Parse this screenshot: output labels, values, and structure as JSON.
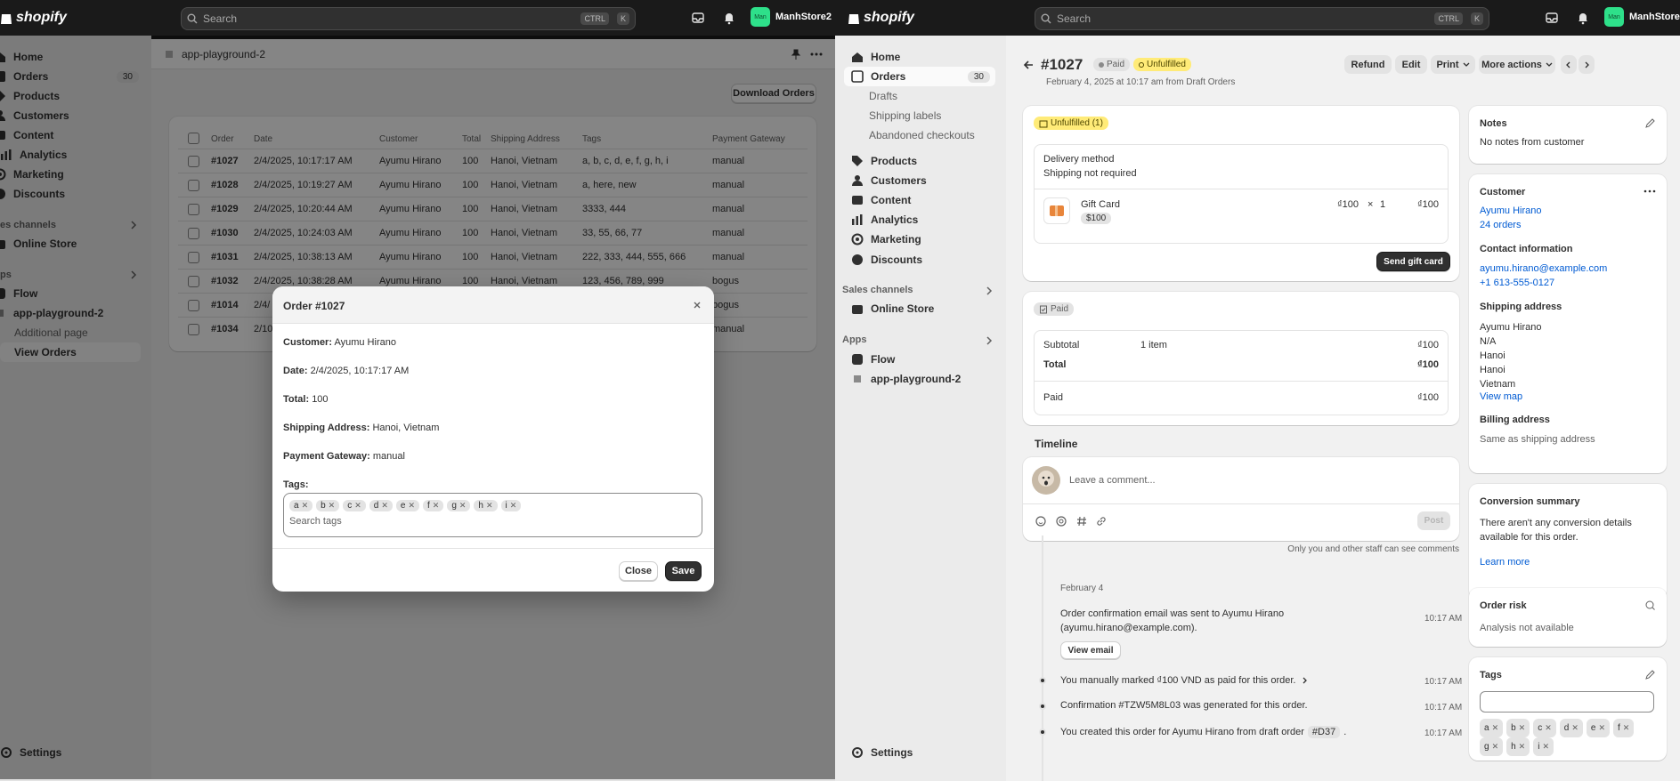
{
  "left": {
    "brand": "shopify",
    "search_placeholder": "Search",
    "kbd": [
      "CTRL",
      "K"
    ],
    "store_name": "ManhStore2",
    "avatar_initials": "Man",
    "nav": [
      {
        "label": "Home"
      },
      {
        "label": "Orders",
        "count": "30"
      },
      {
        "label": "Products"
      },
      {
        "label": "Customers"
      },
      {
        "label": "Content"
      },
      {
        "label": "Analytics"
      },
      {
        "label": "Marketing"
      },
      {
        "label": "Discounts"
      }
    ],
    "sales_channels_label": "es channels",
    "online_store": "Online Store",
    "apps_label": "ps",
    "flow": "Flow",
    "app_name": "app-playground-2",
    "additional_page": "Additional page",
    "view_orders": "View Orders",
    "settings": "Settings",
    "app_header": "app-playground-2",
    "download_button": "Download Orders",
    "table": {
      "headers": [
        "Order",
        "Date",
        "Customer",
        "Total",
        "Shipping Address",
        "Tags",
        "Payment Gateway"
      ],
      "rows": [
        [
          "#1027",
          "2/4/2025, 10:17:17 AM",
          "Ayumu Hirano",
          "100",
          "Hanoi, Vietnam",
          "a, b, c, d, e, f, g, h, i",
          "manual"
        ],
        [
          "#1028",
          "2/4/2025, 10:19:27 AM",
          "Ayumu Hirano",
          "100",
          "Hanoi, Vietnam",
          "a, here, new",
          "manual"
        ],
        [
          "#1029",
          "2/4/2025, 10:20:44 AM",
          "Ayumu Hirano",
          "100",
          "Hanoi, Vietnam",
          "3333, 444",
          "manual"
        ],
        [
          "#1030",
          "2/4/2025, 10:24:03 AM",
          "Ayumu Hirano",
          "100",
          "Hanoi, Vietnam",
          "33, 55, 66, 77",
          "manual"
        ],
        [
          "#1031",
          "2/4/2025, 10:38:13 AM",
          "Ayumu Hirano",
          "100",
          "Hanoi, Vietnam",
          "222, 333, 444, 555, 666",
          "manual"
        ],
        [
          "#1032",
          "2/4/2025, 10:38:28 AM",
          "Ayumu Hirano",
          "100",
          "Hanoi, Vietnam",
          "123, 456, 789, 999",
          "bogus"
        ],
        [
          "#1014",
          "2/4/",
          "",
          "",
          "",
          "",
          "bogus"
        ],
        [
          "#1034",
          "2/10",
          "",
          "",
          "",
          "",
          "manual"
        ]
      ]
    },
    "modal": {
      "title": "Order #1027",
      "customer_label": "Customer:",
      "customer": "Ayumu Hirano",
      "date_label": "Date:",
      "date": "2/4/2025, 10:17:17 AM",
      "total_label": "Total:",
      "total": "100",
      "ship_label": "Shipping Address:",
      "ship": "Hanoi, Vietnam",
      "gateway_label": "Payment Gateway:",
      "gateway": "manual",
      "tags_label": "Tags:",
      "tags": [
        "a",
        "b",
        "c",
        "d",
        "e",
        "f",
        "g",
        "h",
        "i"
      ],
      "tags_placeholder": "Search tags",
      "close": "Close",
      "save": "Save"
    }
  },
  "right": {
    "brand": "shopify",
    "search_placeholder": "Search",
    "kbd": [
      "CTRL",
      "K"
    ],
    "store_name": "ManhStore2",
    "avatar_initials": "Man",
    "nav": [
      {
        "label": "Home"
      },
      {
        "label": "Orders",
        "count": "30"
      }
    ],
    "orders_sub": [
      "Drafts",
      "Shipping labels",
      "Abandoned checkouts"
    ],
    "nav2": [
      "Products",
      "Customers",
      "Content",
      "Analytics",
      "Marketing",
      "Discounts"
    ],
    "sales_channels_label": "Sales channels",
    "online_store": "Online Store",
    "apps_label": "Apps",
    "flow": "Flow",
    "app_name": "app-playground-2",
    "settings": "Settings",
    "order": {
      "number": "#1027",
      "paid_badge": "Paid",
      "unfulfilled_badge": "Unfulfilled",
      "subtitle": "February 4, 2025 at 10:17 am from Draft Orders",
      "actions": [
        "Refund",
        "Edit",
        "Print",
        "More actions"
      ],
      "fulfill_badge": "Unfulfilled (1)",
      "delivery_method_label": "Delivery method",
      "delivery_method": "Shipping not required",
      "item_name": "Gift Card",
      "item_variant": "$100",
      "item_price": "₫100",
      "item_x": "×",
      "item_qty": "1",
      "item_total": "₫100",
      "send_gift_card": "Send gift card",
      "paid_section_badge": "Paid",
      "subtotal_label": "Subtotal",
      "subtotal_items": "1 item",
      "subtotal": "₫100",
      "total_label": "Total",
      "total": "₫100",
      "paid_label": "Paid",
      "paid": "₫100",
      "timeline_title": "Timeline",
      "comment_placeholder": "Leave a comment...",
      "post": "Post",
      "staff_note": "Only you and other staff can see comments",
      "timeline_date": "February 4",
      "events": [
        {
          "text": "Order confirmation email was sent to Ayumu Hirano (ayumu.hirano@example.com).",
          "time": "10:17 AM",
          "button": "View email"
        },
        {
          "text": "You manually marked ₫100 VND as paid for this order.",
          "time": "10:17 AM"
        },
        {
          "text": "Confirmation #TZW5M8L03 was generated for this order.",
          "time": "10:17 AM"
        },
        {
          "text": "You created this order for Ayumu Hirano from draft order",
          "badge": "#D37",
          "time": "10:17 AM"
        }
      ]
    },
    "notes": {
      "title": "Notes",
      "text": "No notes from customer"
    },
    "customer": {
      "title": "Customer",
      "name": "Ayumu Hirano",
      "orders": "24 orders",
      "contact_title": "Contact information",
      "email": "ayumu.hirano@example.com",
      "phone": "+1 613-555-0127",
      "shipping_title": "Shipping address",
      "shipping_lines": [
        "Ayumu Hirano",
        "N/A",
        "Hanoi",
        "Hanoi",
        "Vietnam"
      ],
      "view_map": "View map",
      "billing_title": "Billing address",
      "billing": "Same as shipping address"
    },
    "conversion": {
      "title": "Conversion summary",
      "text": "There aren't any conversion details available for this order.",
      "link": "Learn more"
    },
    "risk": {
      "title": "Order risk",
      "text": "Analysis not available"
    },
    "tags": {
      "title": "Tags",
      "items": [
        "a",
        "b",
        "c",
        "d",
        "e",
        "f",
        "g",
        "h",
        "i"
      ]
    }
  }
}
